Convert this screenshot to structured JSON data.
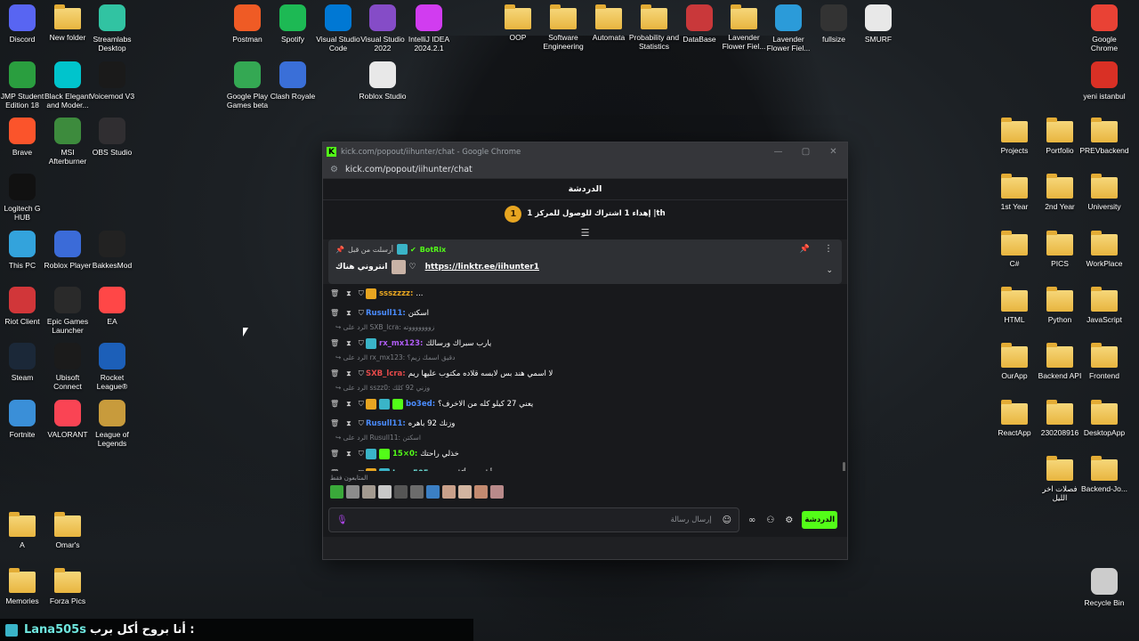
{
  "desktop": {
    "icons": [
      {
        "id": "discord",
        "label": "Discord",
        "glyph": "discord-icon",
        "color": "#5865f2"
      },
      {
        "id": "new-folder",
        "label": "New folder",
        "glyph": "folder-icon",
        "color": "#f0c050"
      },
      {
        "id": "streamlabs",
        "label": "Streamlabs Desktop",
        "glyph": "streamlabs-icon",
        "color": "#31c3a2"
      },
      {
        "id": "postman",
        "label": "Postman",
        "glyph": "postman-icon",
        "color": "#ef5b25"
      },
      {
        "id": "spotify",
        "label": "Spotify",
        "glyph": "spotify-icon",
        "color": "#1db954"
      },
      {
        "id": "vscode",
        "label": "Visual Studio Code",
        "glyph": "vscode-icon",
        "color": "#0078d4"
      },
      {
        "id": "vs2022",
        "label": "Visual Studio 2022",
        "glyph": "visual-studio-icon",
        "color": "#854cc7"
      },
      {
        "id": "intellij",
        "label": "IntelliJ IDEA 2024.2.1",
        "glyph": "intellij-icon",
        "color": "#d13cf0"
      },
      {
        "id": "oop",
        "label": "OOP",
        "glyph": "folder-icon",
        "color": "#f0c050"
      },
      {
        "id": "software-eng",
        "label": "Software Engineering",
        "glyph": "folder-icon",
        "color": "#f0c050"
      },
      {
        "id": "automata",
        "label": "Automata",
        "glyph": "folder-icon",
        "color": "#f0c050"
      },
      {
        "id": "prob-stats",
        "label": "Probability and Statistics",
        "glyph": "folder-icon",
        "color": "#f0c050"
      },
      {
        "id": "database",
        "label": "DataBase",
        "glyph": "database-icon",
        "color": "#c9383a"
      },
      {
        "id": "lavender1",
        "label": "Lavender Flower Fiel...",
        "glyph": "folder-icon",
        "color": "#f0c050"
      },
      {
        "id": "lavender2",
        "label": "Lavender Flower Fiel...",
        "glyph": "edge-icon",
        "color": "#2b9bd9"
      },
      {
        "id": "fullsize",
        "label": "fullsize",
        "glyph": "text-image-icon",
        "color": "#333333"
      },
      {
        "id": "smurf",
        "label": "SMURF",
        "glyph": "document-icon",
        "color": "#e8e8e8"
      },
      {
        "id": "chrome",
        "label": "Google Chrome",
        "glyph": "chrome-icon",
        "color": "#e94235"
      },
      {
        "id": "jmp",
        "label": "JMP Student Edition 18",
        "glyph": "jmp-icon",
        "color": "#2a9e3f"
      },
      {
        "id": "black-elegant",
        "label": "Black Elegant and Moder...",
        "glyph": "canva-icon",
        "color": "#00c4cc"
      },
      {
        "id": "voicemod",
        "label": "Voicemod V3",
        "glyph": "voicemod-icon",
        "color": "#1a1a1a"
      },
      {
        "id": "google-play-games",
        "label": "Google Play Games beta",
        "glyph": "google-play-icon",
        "color": "#34a853"
      },
      {
        "id": "clash-royale",
        "label": "Clash Royale",
        "glyph": "clash-royale-icon",
        "color": "#3a6fd8"
      },
      {
        "id": "roblox-studio",
        "label": "Roblox Studio",
        "glyph": "roblox-studio-icon",
        "color": "#e8e8e8"
      },
      {
        "id": "yeni-istanbul",
        "label": "yeni istanbul",
        "glyph": "pdf-icon",
        "color": "#d93025"
      },
      {
        "id": "brave",
        "label": "Brave",
        "glyph": "brave-icon",
        "color": "#fb542b"
      },
      {
        "id": "msi",
        "label": "MSI Afterburner",
        "glyph": "msi-icon",
        "color": "#3d8b3d"
      },
      {
        "id": "obs",
        "label": "OBS Studio",
        "glyph": "obs-icon",
        "color": "#302e31"
      },
      {
        "id": "projects",
        "label": "Projects",
        "glyph": "folder-icon",
        "color": "#f0c050"
      },
      {
        "id": "portfolio",
        "label": "Portfolio",
        "glyph": "folder-icon",
        "color": "#f0c050"
      },
      {
        "id": "prevbackend",
        "label": "PREVbackend",
        "glyph": "folder-icon",
        "color": "#f0c050"
      },
      {
        "id": "logitech",
        "label": "Logitech G HUB",
        "glyph": "logitech-icon",
        "color": "#111111"
      },
      {
        "id": "1st-year",
        "label": "1st Year",
        "glyph": "folder-icon",
        "color": "#f0c050"
      },
      {
        "id": "2nd-year",
        "label": "2nd Year",
        "glyph": "folder-icon",
        "color": "#f0c050"
      },
      {
        "id": "university",
        "label": "University",
        "glyph": "folder-icon",
        "color": "#f0c050"
      },
      {
        "id": "this-pc",
        "label": "This PC",
        "glyph": "monitor-icon",
        "color": "#33a3dc"
      },
      {
        "id": "roblox-player",
        "label": "Roblox Player",
        "glyph": "roblox-icon",
        "color": "#3b6bd8"
      },
      {
        "id": "bakkesmod",
        "label": "BakkesMod",
        "glyph": "bakkesmod-icon",
        "color": "#222222"
      },
      {
        "id": "csharp",
        "label": "C#",
        "glyph": "folder-icon",
        "color": "#f0c050"
      },
      {
        "id": "pics",
        "label": "PICS",
        "glyph": "folder-icon",
        "color": "#f0c050"
      },
      {
        "id": "workplace",
        "label": "WorkPlace",
        "glyph": "folder-icon",
        "color": "#f0c050"
      },
      {
        "id": "riot",
        "label": "Riot Client",
        "glyph": "riot-icon",
        "color": "#d13639"
      },
      {
        "id": "epic",
        "label": "Epic Games Launcher",
        "glyph": "epic-icon",
        "color": "#2a2a2a"
      },
      {
        "id": "ea",
        "label": "EA",
        "glyph": "ea-icon",
        "color": "#ff4747"
      },
      {
        "id": "html",
        "label": "HTML",
        "glyph": "folder-icon",
        "color": "#f0c050"
      },
      {
        "id": "python",
        "label": "Python",
        "glyph": "folder-icon",
        "color": "#f0c050"
      },
      {
        "id": "javascript",
        "label": "JavaScript",
        "glyph": "folder-icon",
        "color": "#f0c050"
      },
      {
        "id": "steam",
        "label": "Steam",
        "glyph": "steam-icon",
        "color": "#1b2838"
      },
      {
        "id": "ubisoft",
        "label": "Ubisoft Connect",
        "glyph": "ubisoft-icon",
        "color": "#1b1b1b"
      },
      {
        "id": "rocket-league",
        "label": "Rocket League®",
        "glyph": "rocket-league-icon",
        "color": "#1c5fb8"
      },
      {
        "id": "ourapp",
        "label": "OurApp",
        "glyph": "folder-icon",
        "color": "#f0c050"
      },
      {
        "id": "backend-api",
        "label": "Backend API",
        "glyph": "folder-icon",
        "color": "#f0c050"
      },
      {
        "id": "frontend",
        "label": "Frontend",
        "glyph": "folder-icon",
        "color": "#f0c050"
      },
      {
        "id": "fortnite",
        "label": "Fortnite",
        "glyph": "fortnite-icon",
        "color": "#3a8fd8"
      },
      {
        "id": "valorant",
        "label": "VALORANT",
        "glyph": "valorant-icon",
        "color": "#fa4454"
      },
      {
        "id": "lol",
        "label": "League of Legends",
        "glyph": "lol-icon",
        "color": "#c89b3c"
      },
      {
        "id": "reactapp",
        "label": "ReactApp",
        "glyph": "folder-icon",
        "color": "#f0c050"
      },
      {
        "id": "230208916",
        "label": "230208916",
        "glyph": "folder-icon",
        "color": "#f0c050"
      },
      {
        "id": "desktopapp",
        "label": "DesktopApp",
        "glyph": "folder-icon",
        "color": "#f0c050"
      },
      {
        "id": "fasalat",
        "label": "فصلات اخر الليل",
        "glyph": "folder-icon",
        "color": "#f0c050"
      },
      {
        "id": "backend-jo",
        "label": "Backend-Jo...",
        "glyph": "folder-icon",
        "color": "#f0c050"
      },
      {
        "id": "a",
        "label": "A",
        "glyph": "folder-icon",
        "color": "#f0c050"
      },
      {
        "id": "omars",
        "label": "Omar's",
        "glyph": "folder-icon",
        "color": "#f0c050"
      },
      {
        "id": "memories",
        "label": "Memories",
        "glyph": "folder-icon",
        "color": "#f0c050"
      },
      {
        "id": "forza-pics",
        "label": "Forza Pics",
        "glyph": "folder-icon",
        "color": "#f0c050"
      },
      {
        "id": "recycle-bin",
        "label": "Recycle Bin",
        "glyph": "recycle-bin-icon",
        "color": "#cccccc"
      }
    ]
  },
  "window": {
    "title": "kick.com/popout/iihunter/chat - Google Chrome",
    "url": "kick.com/popout/iihunter/chat",
    "controls": {
      "minimize": "—",
      "maximize": "▢",
      "close": "✕"
    }
  },
  "chat": {
    "header": "الدردشة",
    "goal": {
      "level": "1",
      "text": "إهداء 1 اشتراك للوصول للمركز 1 |th"
    },
    "pinned": {
      "meta": "أرسلت من قبل",
      "bot": "BotRix",
      "user_text": "انتروني هناك",
      "link": "https://linktr.ee/iihunter1"
    },
    "messages": [
      {
        "reply": "",
        "user": "ssszzzz",
        "color": "#e7a521",
        "text": "...",
        "badges": [
          "#e7a521"
        ]
      },
      {
        "reply": "",
        "user": "Rusull11",
        "color": "#4a8cff",
        "text": "اسكتن",
        "badges": []
      },
      {
        "reply": "الرد على SXB_lcra: زوووووووته",
        "user": "rx_mx123",
        "color": "#b05cf6",
        "text": "يارب سبراك ورسالك",
        "badges": [
          "#3ab4c8"
        ]
      },
      {
        "reply": "الرد على rx_mx123: دقيق اسمك زيم؟",
        "user": "SXB_lcra",
        "color": "#e64a4a",
        "text": "لا اسمي هند بس لابسه قلاده مكتوب عليها ريم",
        "badges": []
      },
      {
        "reply": "الرد على sszz0: وزني 92 كلك",
        "user": "bo3ed",
        "color": "#4a8cff",
        "text": "يعني 27 كيلو كله من الاخرف؟",
        "badges": [
          "#e7a521",
          "#3ab4c8",
          "#53fc18"
        ]
      },
      {
        "reply": "",
        "user": "Rusull11",
        "color": "#4a8cff",
        "text": "وزنك 92 باهره",
        "badges": []
      },
      {
        "reply": "الرد على Rusull11: اسكتن",
        "user": "15×0",
        "color": "#53fc18",
        "text": "خذلي راحتك",
        "badges": [
          "#3ab4c8",
          "#53fc18"
        ]
      },
      {
        "reply": "",
        "user": "Lana505s",
        "color": "#6fe7df",
        "text": "أنا بروح أكل برب",
        "badges": [
          "#e7a521",
          "#3ab4c8"
        ]
      }
    ],
    "followers_label": "المتابعون فقط",
    "follower_avatars": [
      "#3aa83a",
      "#8c8c8c",
      "#a39a90",
      "#c8c8c8",
      "#555555",
      "#6c6c6c",
      "#3b7fc4",
      "#c9a08a",
      "#d2b4a0",
      "#c38a70",
      "#b98a8a"
    ],
    "input_placeholder": "إرسال رسالة",
    "send_label": "الدردشة"
  },
  "overlay": {
    "user": "Lana505s",
    "text": "أنا بروح أكل برب :"
  }
}
